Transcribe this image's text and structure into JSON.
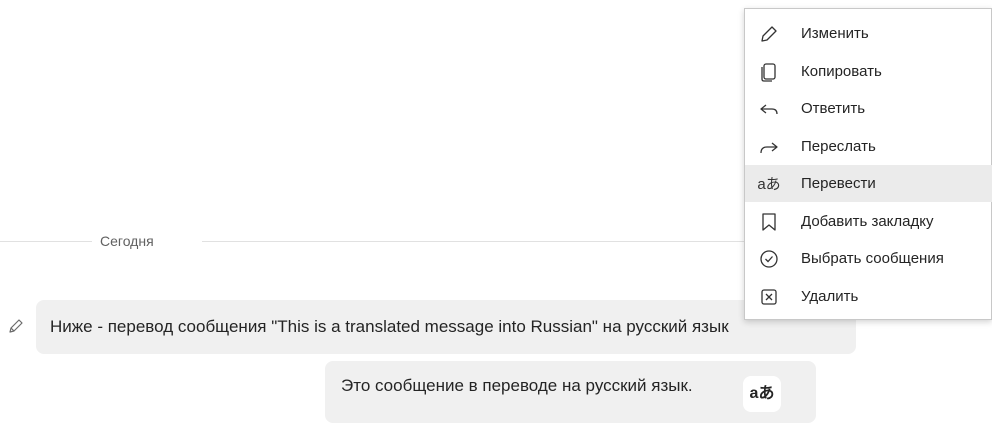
{
  "divider": {
    "label": "Сегодня"
  },
  "messages": {
    "original": {
      "text": "Ниже - перевод сообщения \"This is a translated message into Russian\" на русский язык"
    },
    "translated": {
      "text": "Это сообщение в переводе на русский язык.",
      "chip_glyph": "aあ"
    }
  },
  "context_menu": {
    "items": [
      {
        "label": "Изменить",
        "icon": "pencil-icon"
      },
      {
        "label": "Копировать",
        "icon": "copy-icon"
      },
      {
        "label": "Ответить",
        "icon": "reply-icon"
      },
      {
        "label": "Переслать",
        "icon": "forward-icon"
      },
      {
        "label": "Перевести",
        "icon": "translate-icon",
        "glyph": "aあ",
        "highlighted": true
      },
      {
        "label": "Добавить закладку",
        "icon": "bookmark-icon"
      },
      {
        "label": "Выбрать сообщения",
        "icon": "check-circle-icon"
      },
      {
        "label": "Удалить",
        "icon": "delete-box-icon"
      }
    ]
  }
}
